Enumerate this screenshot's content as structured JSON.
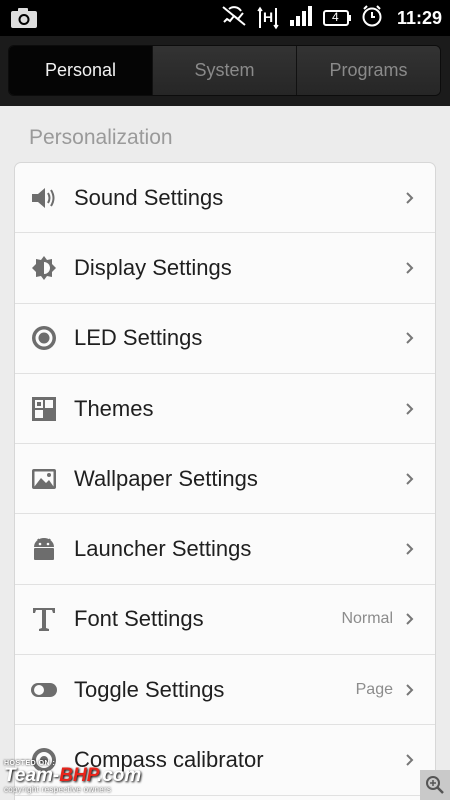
{
  "status_bar": {
    "time": "11:29",
    "network_label": "H",
    "battery_level": "4",
    "icons": [
      "camera-icon",
      "notification-muted-icon",
      "hspa-network-icon",
      "signal-strength-icon",
      "battery-icon",
      "alarm-clock-icon"
    ]
  },
  "tabs": [
    {
      "label": "Personal",
      "active": true
    },
    {
      "label": "System",
      "active": false
    },
    {
      "label": "Programs",
      "active": false
    }
  ],
  "section": {
    "title": "Personalization"
  },
  "items": [
    {
      "label": "Sound Settings",
      "value": "",
      "icon": "speaker-icon"
    },
    {
      "label": "Display Settings",
      "value": "",
      "icon": "brightness-icon"
    },
    {
      "label": "LED Settings",
      "value": "",
      "icon": "led-icon"
    },
    {
      "label": "Themes",
      "value": "",
      "icon": "themes-icon"
    },
    {
      "label": "Wallpaper Settings",
      "value": "",
      "icon": "wallpaper-icon"
    },
    {
      "label": "Launcher Settings",
      "value": "",
      "icon": "android-icon"
    },
    {
      "label": "Font Settings",
      "value": "Normal",
      "icon": "font-icon"
    },
    {
      "label": "Toggle Settings",
      "value": "Page",
      "icon": "toggle-icon"
    },
    {
      "label": "Compass calibrator",
      "value": "",
      "icon": "compass-icon"
    }
  ],
  "watermark": {
    "hosted": "HOSTED ON :",
    "brand_a": "Team-",
    "brand_b": "BHP",
    "brand_c": ".com",
    "copyright": "copyright respective owners"
  },
  "colors": {
    "accent_red": "#e8241b",
    "icon_gray": "#6d6d6d"
  }
}
